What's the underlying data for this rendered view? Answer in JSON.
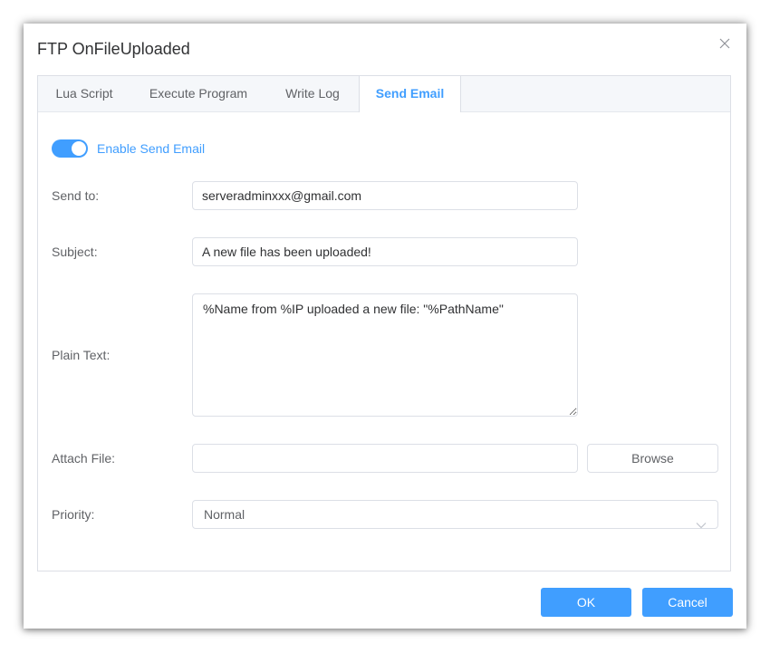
{
  "dialog": {
    "title": "FTP OnFileUploaded"
  },
  "tabs": [
    {
      "label": "Lua Script",
      "active": false
    },
    {
      "label": "Execute Program",
      "active": false
    },
    {
      "label": "Write Log",
      "active": false
    },
    {
      "label": "Send Email",
      "active": true
    }
  ],
  "email": {
    "enable_label": "Enable Send Email",
    "enabled": true,
    "send_to_label": "Send to:",
    "send_to_value": "serveradminxxx@gmail.com",
    "subject_label": "Subject:",
    "subject_value": "A new file has been uploaded!",
    "plain_text_label": "Plain Text:",
    "plain_text_value": "%Name from %IP uploaded a new file: \"%PathName\"",
    "attach_label": "Attach File:",
    "attach_value": "",
    "browse_label": "Browse",
    "priority_label": "Priority:",
    "priority_value": "Normal"
  },
  "footer": {
    "ok_label": "OK",
    "cancel_label": "Cancel"
  },
  "colors": {
    "accent": "#409eff",
    "border": "#dcdfe6",
    "text": "#606266"
  },
  "icons": {
    "close": "close-icon",
    "dropdown": "chevron-down-icon"
  }
}
